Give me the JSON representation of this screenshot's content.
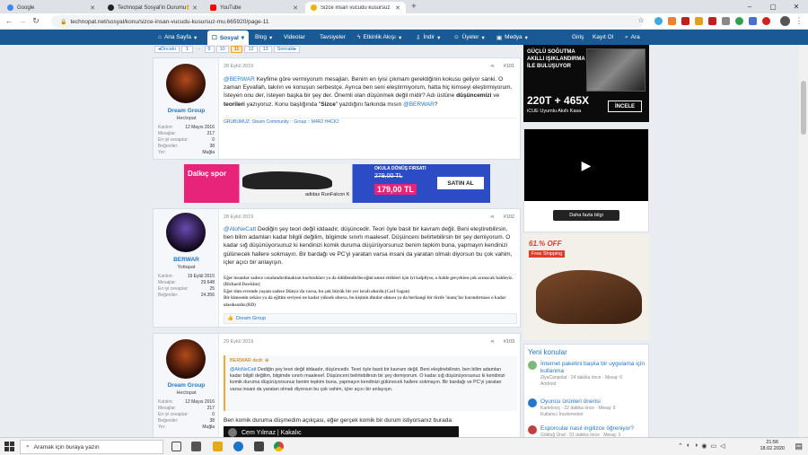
{
  "tabs": [
    {
      "label": "Google",
      "color": "#4285f4"
    },
    {
      "label": "Technopat Sosyal'in Durumu😮",
      "color": "#222222"
    },
    {
      "label": "YouTube",
      "color": "#ff0000"
    },
    {
      "label": "Sizce insan vücudu kusursuz mu?",
      "color": "#f0b400"
    }
  ],
  "new_tab": "+",
  "url": "technopat.net/sosyal/konu/sizce-insan-vucudu-kusursuz-mu.665920/page-11",
  "nav": {
    "home": "Ana Sayfa",
    "social": "Sosyal",
    "blog": "Blog",
    "videos": "Videolar",
    "recommendations": "Tavsiyeler",
    "activity": "Etkinlik Akışı",
    "download": "İndir",
    "members": "Üyeler",
    "media": "Medya",
    "login": "Giriş",
    "register": "Kayıt Ol",
    "search": "Ara"
  },
  "pagination": {
    "prev": "◂Önceki",
    "pages": [
      "1",
      "...",
      "9",
      "10",
      "11",
      "12",
      "13"
    ],
    "current": "11",
    "next": "Sonraki▸"
  },
  "posts": [
    {
      "date": "28 Eylül 2019",
      "number": "#101",
      "username": "Dream Group",
      "user_title": "Hectopat",
      "stats": [
        [
          "Katılım:",
          "12 Mayıs 2016"
        ],
        [
          "Mesajlar:",
          "217"
        ],
        [
          "En iyi cevaplar:",
          "0"
        ],
        [
          "Beğeniler:",
          "38"
        ],
        [
          "Yer:",
          "Muğla"
        ]
      ],
      "mention": "@BERWAR",
      "text1": " Keyfime göre vermiyorum mesajları. Benim en iyisi çıkmam gerektiğinin kokusu geliyor sanki. O zaman Eyvallah, takılın ve konuşun serbestçe. Ayrıca ben seni eleştirmiyorum, hatta hiç kimseyi eleştirmiyorum. İsteyen onu der, isteyen başka bir şey der. Önemli olan düşünmek değil midir? Adı üstüne ",
      "bold1": "düşüncemizi",
      "text2": " ve ",
      "bold2": "teorileri",
      "text3": " yazıyoruz. Konu başlığında \"",
      "bold3": "Sizce",
      "text4": "\" yazdığını farkında mısın ",
      "mention2": "@BERWAR",
      "text5": "?",
      "signature": "GRUBUMUZ: Steam Community :: Group :: M4R2 H4CK2"
    },
    {
      "date": "28 Eylül 2019",
      "number": "#102",
      "username": "BERWAR",
      "user_title": "Yottapat",
      "stats": [
        [
          "Katılım:",
          "19 Eylül 2015"
        ],
        [
          "Mesajlar:",
          "29.648"
        ],
        [
          "En iyi cevaplar:",
          "25"
        ],
        [
          "Beğeniler:",
          "24.356"
        ]
      ],
      "mention": "@AloNeCatt",
      "text1": " Dediğin şey teori değil iddaadır, düşüncedir. Teori öyle basit bir kavram değil. Beni eleştirebilirsin, ben bilim adamları kadar bilgili değilim, bilgimde sınırlı maalesef. Düşünceni belirtebilirsin bir şey demiyorum. O kadar sığ düşünüyorsunuz ki kendinizi komik duruma düşürüyorsunuz benim tepkim buna, yapmayın kendinizi gülünecek hallere sokmayın. Bir bardağı ve PC'yi yaratan varsa insani da yaratan olmalı diyorsun bu çok vahim, içler açıcı bir anlayışın.",
      "sig1": "Eğer insanlar sadece cezalandırılmaktan korktukları ya da ödüllendirileceğini umut ettikleri için iyi kalpliyse, o halde gerçekten çok acınacak haldeyiz.(Richard Dawkins)",
      "sig2": "Eğer tüm evrende yaşam sadece Dünya'da varsa, bu çok büyük bir yer israfı olurdu.(Carl Sagan)",
      "sig3": "Bir kimsenin zekâsı ya da eğitim seviyesi ne kadar yüksek olursa, bu kişinin dindar olması ya da herhangi bir türde 'inanç'lar barındırması o kadar olasıksızdır.(RD)",
      "reaction": "Dream Group"
    },
    {
      "date": "29 Eylül 2019",
      "number": "#103",
      "username": "Dream Group",
      "user_title": "Hectopat",
      "stats": [
        [
          "Katılım:",
          "12 Mayıs 2016"
        ],
        [
          "Mesajlar:",
          "217"
        ],
        [
          "En iyi cevaplar:",
          "0"
        ],
        [
          "Beğeniler:",
          "38"
        ],
        [
          "Yer:",
          "Muğla"
        ]
      ],
      "quote_author": "BERWAR dedi: ⊕",
      "quote_mention": "@AloNeCatt",
      "quote_text": " Dediğin şey teori değil iddaadır, düşüncedir. Teori öyle basit bir kavram değil. Beni eleştirebilirsin, ben bilim adamları kadar bilgili değilim, bilgimde sınırlı maalesef. Düşünceni belirtebilirsin bir şey demiyorum. O kadar sığ düşünüyorsunuz ki kendinizi komik duruma düşürüyorsunuz benim tepkim buna, yapmayın kendinizi gülünecek hallere sokmayın. Bir bardağı ve PC'yi yaratan varsa insani da yaratan olmalı diyorsun bu çok vahim, içler açıcı bir anlayışın.",
      "text": "Ben komik duruma düşmedim açıkçası, eğer gerçek komik bir durum istiyorsanız burada:",
      "video_title": "Cem Yılmaz | Kakalıc"
    }
  ],
  "banner_ad": {
    "brand": "Dalkıç spor",
    "headline": "OKULA DÖNÜŞ FIRSATI",
    "old_price": "279,00 TL",
    "new_price": "179,00 TL",
    "product": "adidas RunFalcon K",
    "cta": "SATIN AL"
  },
  "right_ad1": {
    "line1": "GÜÇLÜ SOĞUTMA",
    "line2": "AKILLI IŞIKLANDIRMA",
    "line3": "İLE BULUŞUYOR",
    "model": "220T + 465X",
    "sub": "iCUE Uyumlu Akıllı Kasa",
    "cta": "İNCELE"
  },
  "right_ad2": {
    "cta": "Daha fazla bilgi"
  },
  "right_ad3": {
    "badge": "61.% OFF",
    "sub": "Free Shipping"
  },
  "new_topics": {
    "title": "Yeni konular",
    "items": [
      {
        "title": "İnternet paketini başka bir uygulama için kullanma",
        "meta1": "ZiyaCanpolat · 24 dakika önce · Mesaj: 0",
        "meta2": "Android",
        "color": "#7cb87c"
      },
      {
        "title": "Oyuncu ürünleri önerisi",
        "meta1": "Karteloviç · 32 dakika önce · Mesaj: 9",
        "meta2": "Kullanıcı İncelemeleri",
        "color": "#2576c8"
      },
      {
        "title": "Esporcular nasıl ingilizce öğreniyor?",
        "meta1": "Göktuğ Ünal · 51 dakika önce · Mesaj: 3",
        "meta2": "",
        "color": "#c04040"
      }
    ]
  },
  "taskbar": {
    "search_placeholder": "Aramak için buraya yazın",
    "time": "21:56",
    "date": "18.02.2020"
  }
}
